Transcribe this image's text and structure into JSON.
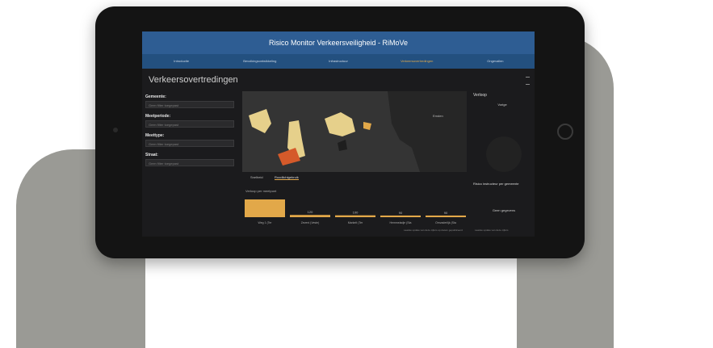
{
  "app": {
    "title": "Risico Monitor Verkeersveiligheid - RiMoVe",
    "page_title": "Verkeersovertredingen"
  },
  "nav": {
    "items": [
      {
        "label": "Introductie"
      },
      {
        "label": "Bevolkingsontwikkeling"
      },
      {
        "label": "Infrastructuur"
      },
      {
        "label": "Verkeersovertredingen"
      },
      {
        "label": "Ongevallen"
      }
    ],
    "active_index": 3
  },
  "filters": [
    {
      "label": "Gemeente:",
      "placeholder": "Geen filter toegepast"
    },
    {
      "label": "Meetperiode:",
      "placeholder": "Geen filter toegepast"
    },
    {
      "label": "Meettype:",
      "placeholder": "Geen filter toegepast"
    },
    {
      "label": "Straat:",
      "placeholder": "Geen filter toegepast"
    }
  ],
  "map": {
    "place_label": "Emden",
    "tabs": [
      "Snelheid",
      "Roodlichtgebruik"
    ],
    "active_tab": 1
  },
  "chart_data": {
    "type": "bar",
    "title": "Verloop per meetpunt",
    "categories": [
      "Weg 1 (Ter",
      "Zeveni (Veste)",
      "Markelt (Ter",
      "Hemmeladje (Sta",
      "Omvaderlijk (Sta"
    ],
    "values": [
      950,
      120,
      100,
      90,
      90
    ],
    "value_labels": [
      "",
      "120",
      "100",
      "90",
      "90"
    ],
    "color": "#e2a849"
  },
  "right_panel": {
    "heading": "Verloop",
    "button_top": "Vorige",
    "section_title": "Risico instructeur per gemeente",
    "button_bottom": "Geen gegevens"
  },
  "footer": {
    "note_left": "Laatste update van deze cijfers op datum gepubliceerd",
    "note_right": "Laatste update van deze cijfers"
  }
}
